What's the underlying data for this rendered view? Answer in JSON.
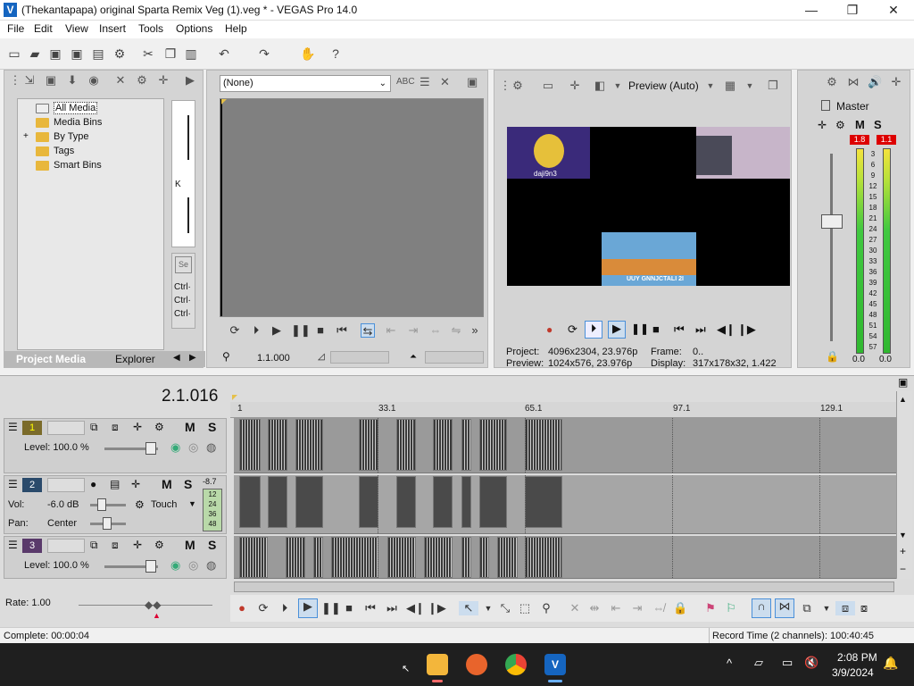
{
  "window": {
    "title": "(Thekantapapa) original Sparta Remix Veg (1).veg * - VEGAS Pro 14.0",
    "minimize": "—",
    "maximize": "❐",
    "close": "✕"
  },
  "menu": [
    "File",
    "Edit",
    "View",
    "Insert",
    "Tools",
    "Options",
    "Help"
  ],
  "project_media": {
    "tree": [
      "All Media",
      "Media Bins",
      "By Type",
      "Tags",
      "Smart Bins"
    ],
    "expand": "+",
    "tabs": [
      "Project Media",
      "Explorer"
    ],
    "side_labels": [
      "Ctrl·",
      "Ctrl·",
      "Ctrl·"
    ],
    "side_k": "K"
  },
  "trimmer": {
    "select": "(None)",
    "time": "1.1.000"
  },
  "preview": {
    "mode": "Preview (Auto)",
    "project_label": "Project:",
    "project_value": "4096x2304, 23.976p",
    "preview_label": "Preview:",
    "preview_value": "1024x576, 23.976p",
    "frame_label": "Frame:",
    "frame_value": "0..",
    "display_label": "Display:",
    "display_value": "317x178x32, 1.422",
    "thumb1_caption": "daji9n3",
    "thumb3_caption": "UUY GNNJCTALI 2I"
  },
  "master": {
    "label": "Master",
    "peak_left": "1.8",
    "peak_right": "1.1",
    "scale": [
      "3",
      "6",
      "9",
      "12",
      "15",
      "18",
      "21",
      "24",
      "27",
      "30",
      "33",
      "36",
      "39",
      "42",
      "45",
      "48",
      "51",
      "54",
      "57"
    ],
    "bottom_left": "0.0",
    "bottom_right": "0.0",
    "m": "M",
    "s": "S"
  },
  "timeline": {
    "time": "2.1.016",
    "ruler": [
      "1",
      "33.1",
      "65.1",
      "97.1",
      "129.1"
    ],
    "tracks": [
      {
        "num": "1",
        "level": "Level: 100.0 %"
      },
      {
        "num": "2",
        "vol_label": "Vol:",
        "vol": "-6.0 dB",
        "pan_label": "Pan:",
        "pan": "Center",
        "touch": "Touch",
        "meter_top": "-8.7",
        "meter_scale": [
          "12",
          "24",
          "36",
          "48"
        ]
      },
      {
        "num": "3",
        "level": "Level: 100.0 %"
      }
    ],
    "m": "M",
    "s": "S",
    "rate": "Rate: 1.00"
  },
  "status": {
    "complete": "Complete: 00:00:04",
    "record": "Record Time (2 channels): 100:40:45"
  },
  "taskbar": {
    "time": "2:08 PM",
    "date": "3/9/2024"
  }
}
